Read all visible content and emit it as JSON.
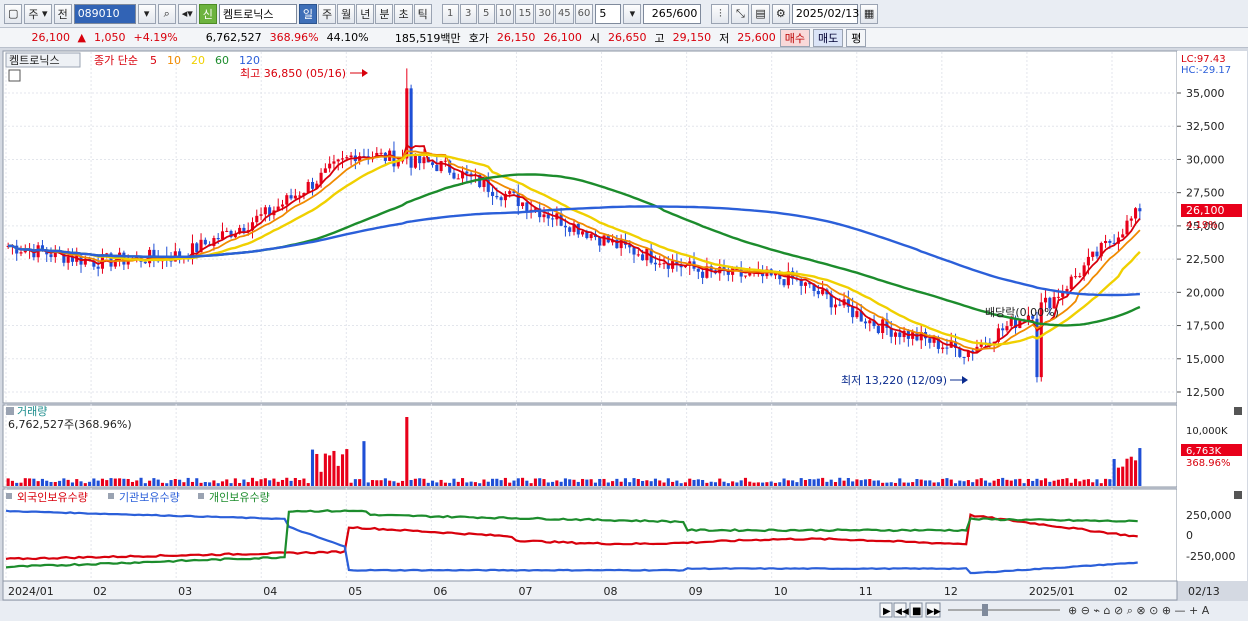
{
  "toolbar": {
    "type_label": "주",
    "prev_label": "전",
    "code": "089010",
    "credit_label": "신",
    "stock_name": "켐트로닉스",
    "periods": [
      "일",
      "주",
      "월",
      "년",
      "분",
      "초",
      "틱"
    ],
    "active_period": "일",
    "intervals": [
      "1",
      "3",
      "5",
      "10",
      "15",
      "30",
      "45",
      "60"
    ],
    "interval_value": "5",
    "count": "265",
    "count_total": "/600",
    "date": "2025/02/13"
  },
  "quote": {
    "price": "26,100",
    "change": "1,050",
    "change_pct": "+4.19%",
    "volume": "6,762,527",
    "volume_ratio": "368.96%",
    "turnover": "44.10%",
    "amount": "185,519백만",
    "bid_label": "호가",
    "ask": "26,150",
    "bid": "26,100",
    "open_label": "시",
    "open": "26,650",
    "high_label": "고",
    "high": "29,150",
    "low_label": "저",
    "low": "25,600",
    "buy_label": "매수",
    "sell_label": "매도",
    "eval_label": "평"
  },
  "price_panel": {
    "stock_tag": "켐트로닉스",
    "ma_legend_prefix": "종가 단순",
    "ma_periods": [
      "5",
      "10",
      "20",
      "60",
      "120"
    ],
    "ma_colors": [
      "#d8000c",
      "#f08a00",
      "#f0d000",
      "#1c8c2c",
      "#2b5fd9"
    ],
    "lc_label": "LC:97.43",
    "hc_label": "HC:-29.17",
    "high_annotation": "최고 36,850 (05/16)",
    "low_annotation": "최저 13,220 (12/09)",
    "dividend_annotation": "배당락(0.00%)",
    "current_price_tag": "26,100",
    "current_pct_tag": "4.19%",
    "y_ticks": [
      "35,000",
      "32,500",
      "30,000",
      "27,500",
      "25,000",
      "22,500",
      "20,000",
      "17,500",
      "15,000",
      "12,500"
    ]
  },
  "volume_panel": {
    "title": "거래량",
    "value_label": "6,762,527주(368.96%)",
    "y_tick": "10,000K",
    "current_tag": "6,763K",
    "current_pct": "368.96%"
  },
  "holdings_panel": {
    "legend": [
      "외국인보유수량",
      "기관보유수량",
      "개인보유수량"
    ],
    "legend_colors": [
      "#d8000c",
      "#2b5fd9",
      "#1c8c2c"
    ],
    "y_ticks": [
      "250,000",
      "0",
      "-250,000"
    ]
  },
  "x_axis": {
    "labels": [
      "2024/01",
      "02",
      "03",
      "04",
      "05",
      "06",
      "07",
      "08",
      "09",
      "10",
      "11",
      "12",
      "2025/01",
      "02"
    ],
    "right_label": "02/13"
  },
  "chart_data": {
    "type": "candlestick",
    "price_range": [
      12500,
      36850
    ],
    "current_price": 26100,
    "high": 36850,
    "low": 13220,
    "monthly_close": [
      {
        "month": "2024/01",
        "value": 23500
      },
      {
        "month": "02",
        "value": 22300
      },
      {
        "month": "03",
        "value": 22800
      },
      {
        "month": "04",
        "value": 26000
      },
      {
        "month": "05",
        "value": 30500
      },
      {
        "month": "06",
        "value": 29500
      },
      {
        "month": "07",
        "value": 26500
      },
      {
        "month": "08",
        "value": 23500
      },
      {
        "month": "09",
        "value": 21500
      },
      {
        "month": "10",
        "value": 21000
      },
      {
        "month": "11",
        "value": 17500
      },
      {
        "month": "12",
        "value": 15500
      },
      {
        "month": "2025/01",
        "value": 19500
      },
      {
        "month": "02",
        "value": 26100
      }
    ]
  }
}
